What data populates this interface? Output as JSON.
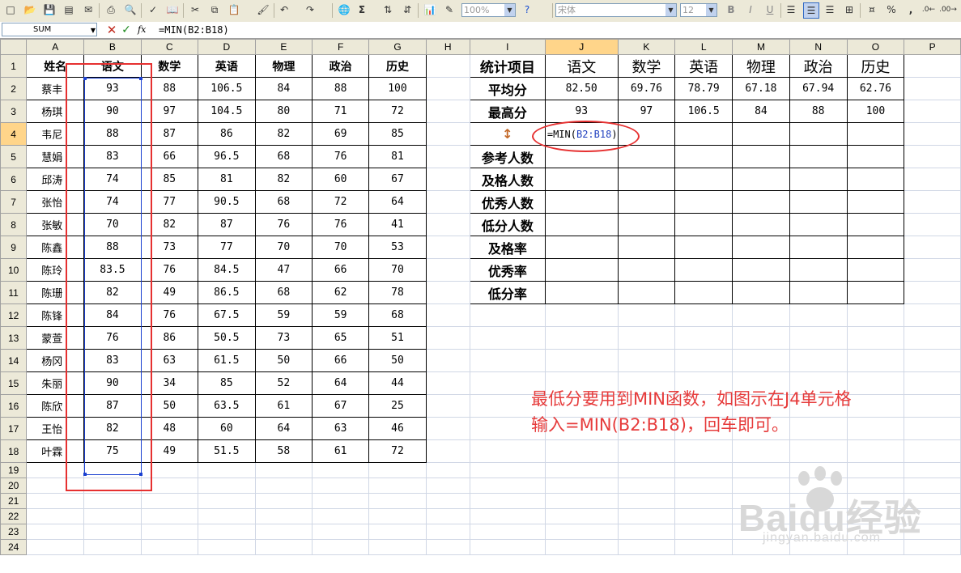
{
  "toolbar": {
    "zoom": "100%",
    "font_name": "宋体",
    "font_size": "12",
    "bold": "B",
    "italic": "I",
    "underline": "U",
    "percent": "%",
    "comma": ","
  },
  "formula_bar": {
    "name_box": "SUM",
    "fx": "fx",
    "formula": "=MIN(B2:B18)"
  },
  "columns": [
    "A",
    "B",
    "C",
    "D",
    "E",
    "F",
    "G",
    "H",
    "I",
    "J",
    "K",
    "L",
    "M",
    "N",
    "O",
    "P"
  ],
  "rows": [
    "1",
    "2",
    "3",
    "4",
    "5",
    "6",
    "7",
    "8",
    "9",
    "10",
    "11",
    "12",
    "13",
    "14",
    "15",
    "16",
    "17",
    "18",
    "19",
    "20",
    "21",
    "22",
    "23",
    "24"
  ],
  "score_table": {
    "headers": [
      "姓名",
      "语文",
      "数学",
      "英语",
      "物理",
      "政治",
      "历史"
    ],
    "rows": [
      [
        "蔡丰",
        "93",
        "88",
        "106.5",
        "84",
        "88",
        "100"
      ],
      [
        "杨琪",
        "90",
        "97",
        "104.5",
        "80",
        "71",
        "72"
      ],
      [
        "韦尼",
        "88",
        "87",
        "86",
        "82",
        "69",
        "85"
      ],
      [
        "慧娟",
        "83",
        "66",
        "96.5",
        "68",
        "76",
        "81"
      ],
      [
        "邱涛",
        "74",
        "85",
        "81",
        "82",
        "60",
        "67"
      ],
      [
        "张怡",
        "74",
        "77",
        "90.5",
        "68",
        "72",
        "64"
      ],
      [
        "张敏",
        "70",
        "82",
        "87",
        "76",
        "76",
        "41"
      ],
      [
        "陈鑫",
        "88",
        "73",
        "77",
        "70",
        "70",
        "53"
      ],
      [
        "陈玲",
        "83.5",
        "76",
        "84.5",
        "47",
        "66",
        "70"
      ],
      [
        "陈珊",
        "82",
        "49",
        "86.5",
        "68",
        "62",
        "78"
      ],
      [
        "陈锋",
        "84",
        "76",
        "67.5",
        "59",
        "59",
        "68"
      ],
      [
        "蒙萱",
        "76",
        "86",
        "50.5",
        "73",
        "65",
        "51"
      ],
      [
        "杨冈",
        "83",
        "63",
        "61.5",
        "50",
        "66",
        "50"
      ],
      [
        "朱丽",
        "90",
        "34",
        "85",
        "52",
        "64",
        "44"
      ],
      [
        "陈欣",
        "87",
        "50",
        "63.5",
        "61",
        "67",
        "25"
      ],
      [
        "王怡",
        "82",
        "48",
        "60",
        "64",
        "63",
        "46"
      ],
      [
        "叶霖",
        "75",
        "49",
        "51.5",
        "58",
        "61",
        "72"
      ]
    ]
  },
  "stats_table": {
    "title": "统计项目",
    "subjects": [
      "语文",
      "数学",
      "英语",
      "物理",
      "政治",
      "历史"
    ],
    "labels": [
      "平均分",
      "最高分",
      "",
      "参考人数",
      "及格人数",
      "优秀人数",
      "低分人数",
      "及格率",
      "优秀率",
      "低分率"
    ],
    "averages": [
      "82.50",
      "69.76",
      "78.79",
      "67.18",
      "67.94",
      "62.76"
    ],
    "maxima": [
      "93",
      "97",
      "106.5",
      "84",
      "88",
      "100"
    ],
    "row4_marker": "↕",
    "editing_prefix": "=MIN(",
    "editing_ref": "B2:B18",
    "editing_suffix": ")"
  },
  "annotation": {
    "line1": "最低分要用到MIN函数，如图示在J4单元格",
    "line2": "输入=MIN(B2:B18)，回车即可。"
  },
  "watermark": {
    "brand": "Baidu经验",
    "url": "jingyan.baidu.com"
  },
  "colors": {
    "stat_title": "#e01e1e",
    "subject_header": "#1f4fd8",
    "stat_label": "#8b3a1a",
    "annotation": "#e63b3b",
    "selection": "#1a3fd0",
    "cancel": "#c0281c",
    "enter": "#1d8a1d"
  }
}
